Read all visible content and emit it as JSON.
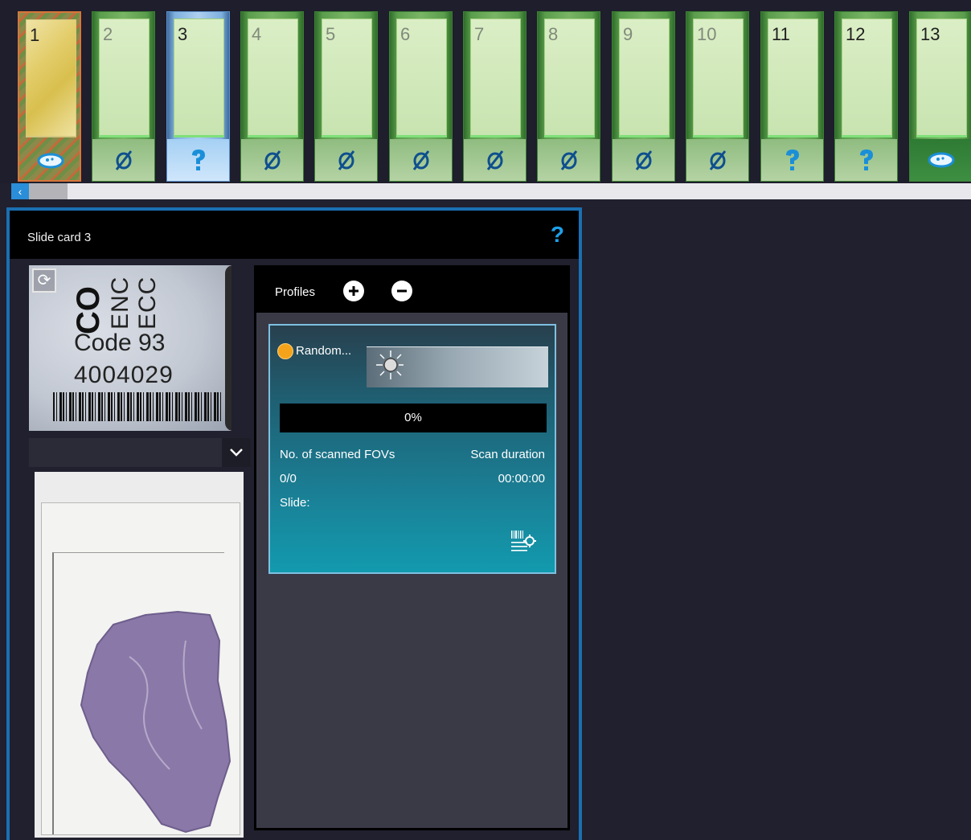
{
  "slide_strip": {
    "slots": [
      {
        "number": "1",
        "status": "loaded"
      },
      {
        "number": "2",
        "status": "empty"
      },
      {
        "number": "3",
        "status": "unknown",
        "selected": true
      },
      {
        "number": "4",
        "status": "empty"
      },
      {
        "number": "5",
        "status": "empty"
      },
      {
        "number": "6",
        "status": "empty"
      },
      {
        "number": "7",
        "status": "empty"
      },
      {
        "number": "8",
        "status": "empty"
      },
      {
        "number": "9",
        "status": "empty"
      },
      {
        "number": "10",
        "status": "empty"
      },
      {
        "number": "11",
        "status": "unknown"
      },
      {
        "number": "12",
        "status": "unknown"
      },
      {
        "number": "13",
        "status": "loaded"
      }
    ],
    "scroll_arrow": "‹",
    "status_icons": {
      "empty": "empty-slot-icon",
      "unknown": "question-icon",
      "loaded": "slide-loaded-icon"
    },
    "colors": {
      "selected": "#aed0f0",
      "default": "#79b565",
      "help": "#1ea0ea"
    }
  },
  "slide_card": {
    "title": "Slide card 3",
    "help": "?",
    "label_image": {
      "text_top": "CO",
      "text_mid1": "ENC",
      "text_mid2": "ECC",
      "code_title": "Code 93",
      "code_number": "4004029"
    },
    "profiles": {
      "title": "Profiles",
      "profile": {
        "name": "Random...",
        "progress_text": "0%",
        "progress_value": 0,
        "fovs_label": "No. of scanned FOVs",
        "fovs_value": "0/0",
        "duration_label": "Scan duration",
        "duration_value": "00:00:00",
        "slide_label": "Slide:",
        "status_color": "#f5a31a"
      }
    }
  }
}
